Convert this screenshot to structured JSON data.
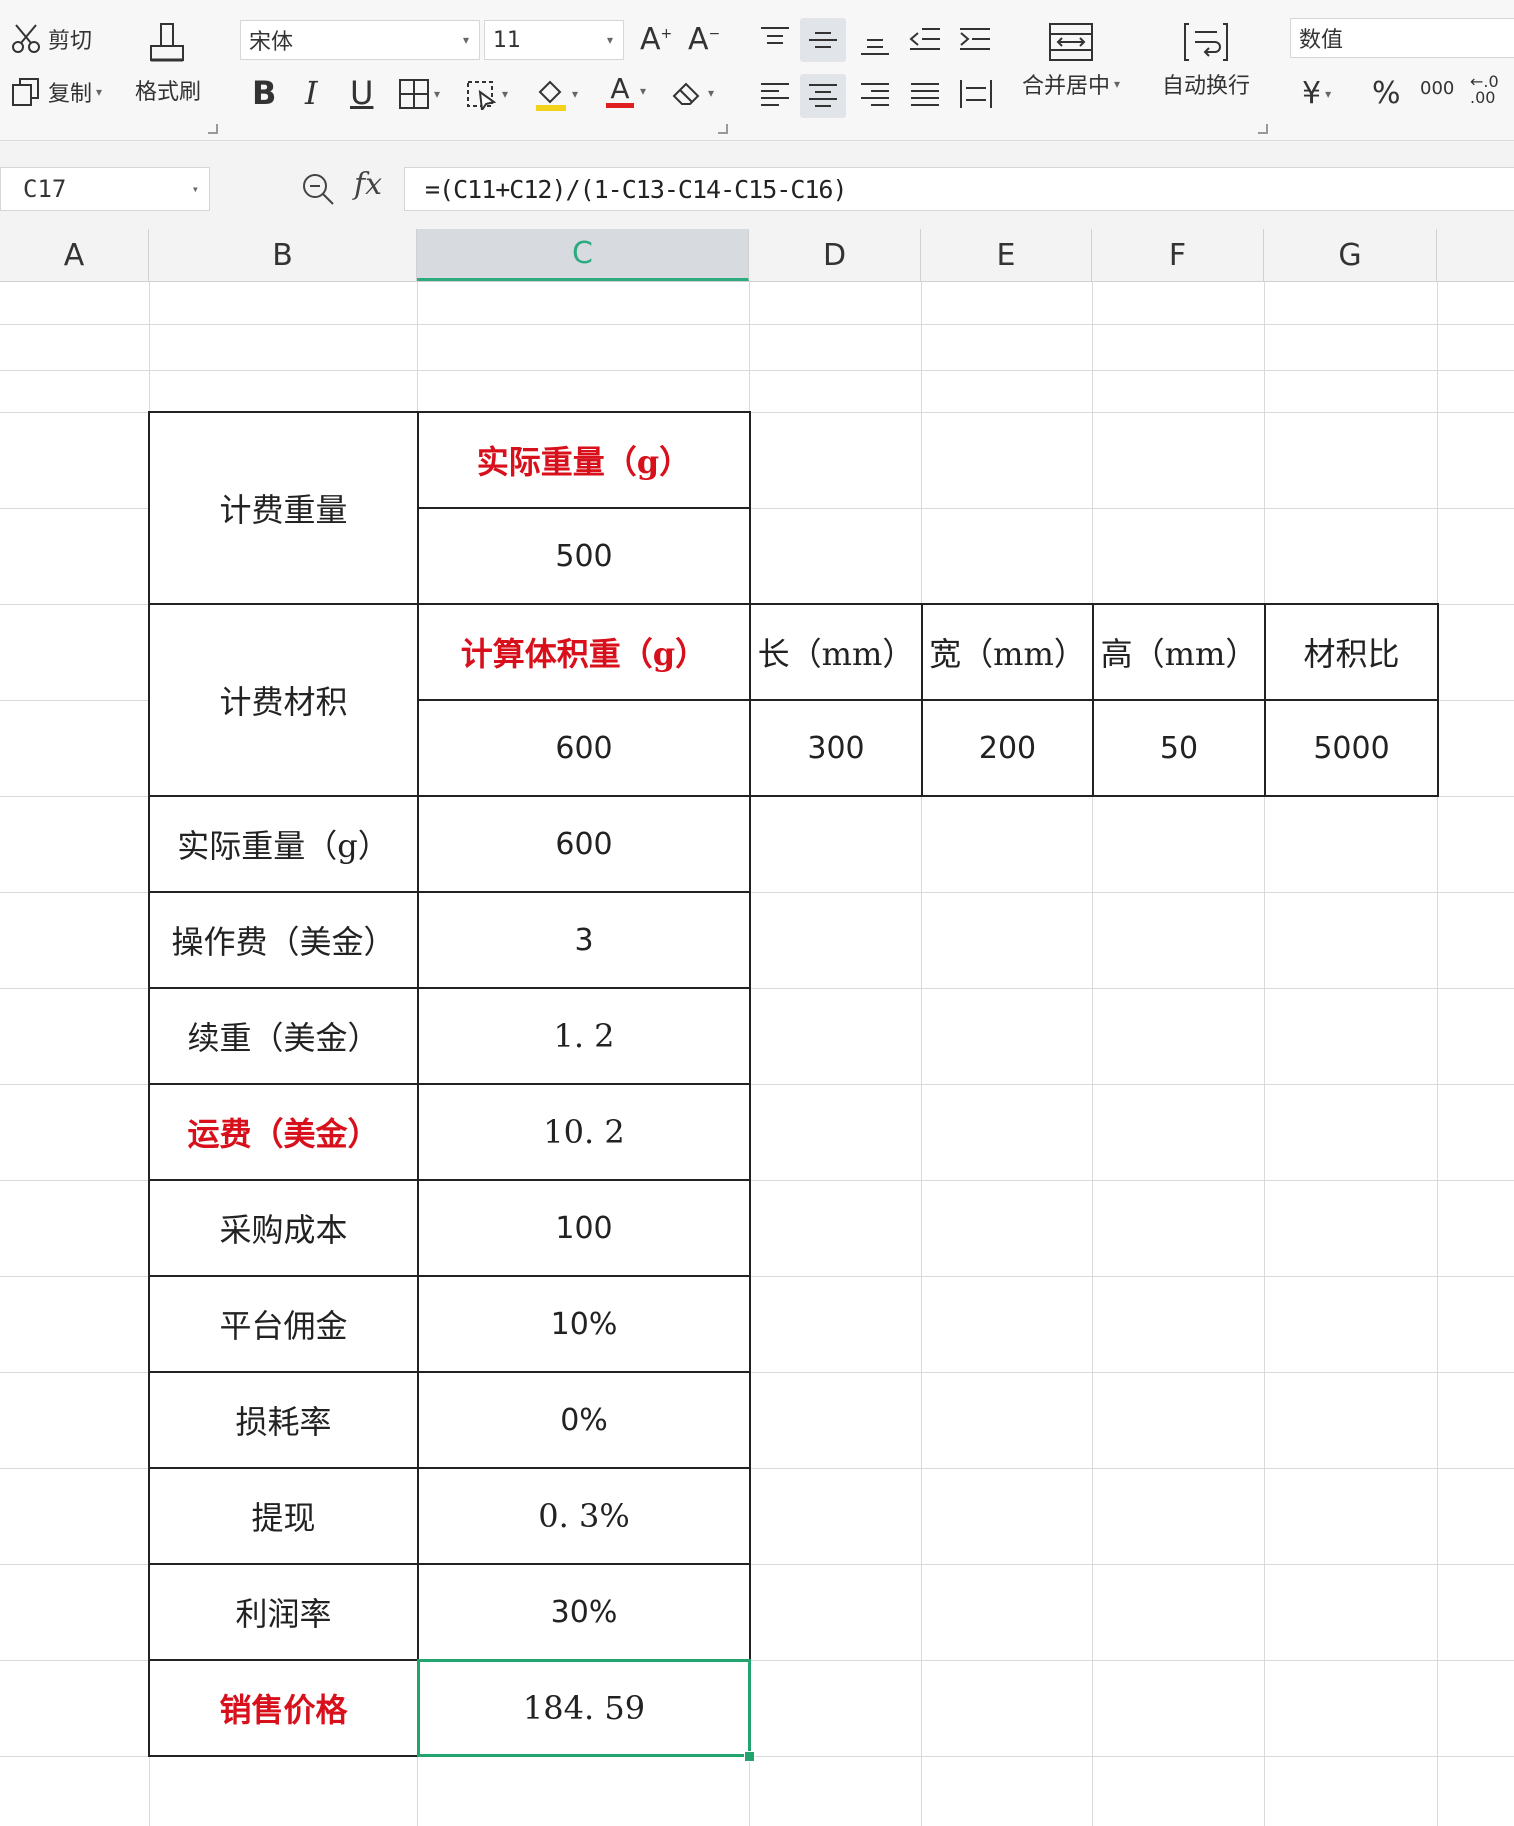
{
  "ribbon": {
    "cut_label": "剪切",
    "copy_label": "复制",
    "format_painter_label": "格式刷",
    "font_name": "宋体",
    "font_size": "11",
    "merge_label": "合并居中",
    "wrap_label": "自动换行",
    "number_format": "数值",
    "currency_symbol": "¥",
    "percent_symbol": "%",
    "thousands_symbol": "000",
    "decimal_symbol": "←.0 .00"
  },
  "formula_bar": {
    "cell_ref": "C17",
    "fx_label": "fx",
    "formula": "=(C11+C12)/(1-C13-C14-C15-C16)"
  },
  "columns": [
    "A",
    "B",
    "C",
    "D",
    "E",
    "F",
    "G"
  ],
  "active_column": "C",
  "table": {
    "billing_weight_label": "计费重量",
    "actual_weight_header": "实际重量（g）",
    "actual_weight_value": "500",
    "billing_volume_label": "计费材积",
    "calc_volume_weight_header": "计算体积重（g）",
    "calc_volume_weight_value": "600",
    "length_header": "长（mm）",
    "width_header": "宽（mm）",
    "height_header": "高（mm）",
    "volume_ratio_header": "材积比",
    "length_value": "300",
    "width_value": "200",
    "height_value": "50",
    "volume_ratio_value": "5000",
    "rows": [
      {
        "label": "实际重量（g）",
        "value": "600",
        "highlight": false
      },
      {
        "label": "操作费（美金）",
        "value": "3",
        "highlight": false
      },
      {
        "label": "续重（美金）",
        "value": "1. 2",
        "highlight": false
      },
      {
        "label": "运费（美金）",
        "value": "10. 2",
        "highlight": true
      },
      {
        "label": "采购成本",
        "value": "100",
        "highlight": false
      },
      {
        "label": "平台佣金",
        "value": "10%",
        "highlight": false
      },
      {
        "label": "损耗率",
        "value": "0%",
        "highlight": false
      },
      {
        "label": "提现",
        "value": "0. 3%",
        "highlight": false
      },
      {
        "label": "利润率",
        "value": "30%",
        "highlight": false
      }
    ],
    "sale_price_label": "销售价格",
    "sale_price_value": "184. 59"
  },
  "colors": {
    "accent_green": "#23a46f",
    "red_text": "#d8101c"
  }
}
